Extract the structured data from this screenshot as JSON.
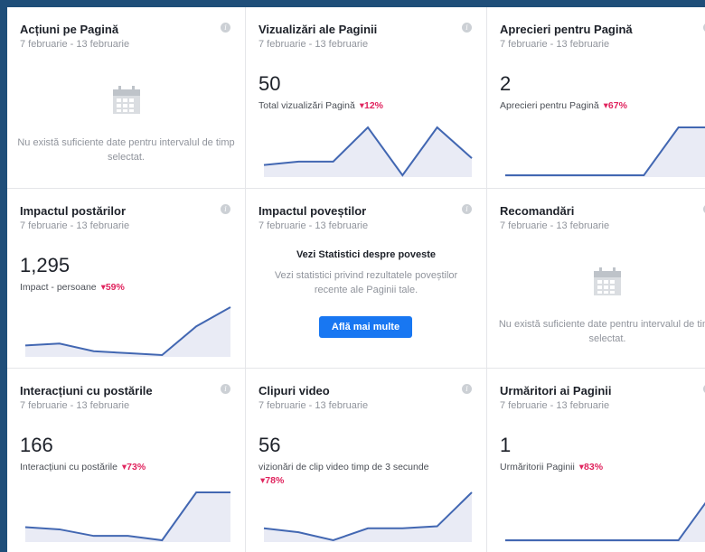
{
  "date_range": "7 februarie - 13 februarie",
  "empty_message": "Nu există suficiente date pentru intervalul de timp selectat.",
  "info_glyph": "i",
  "colors": {
    "accent": "#1877f2",
    "negative": "#e0245e",
    "line": "#4267b2",
    "fill": "#e9ebf5"
  },
  "cards": {
    "page_actions": {
      "title": "Acțiuni pe Pagină"
    },
    "page_views": {
      "title": "Vizualizări ale Paginii",
      "value": "50",
      "metric": "Total vizualizări Pagină",
      "delta": "▾12%",
      "trend": [
        3,
        4,
        4,
        14,
        0,
        14,
        5
      ]
    },
    "page_likes": {
      "title": "Aprecieri pentru Pagină",
      "value": "2",
      "metric": "Aprecieri pentru Pagină",
      "delta": "▾67%",
      "trend": [
        0,
        0,
        0,
        0,
        0,
        1,
        1
      ]
    },
    "post_reach": {
      "title": "Impactul postărilor",
      "value": "1,295",
      "metric": "Impact - persoane",
      "delta": "▾59%",
      "trend": [
        4,
        4.5,
        2.5,
        2,
        1.5,
        9,
        14
      ]
    },
    "story_reach": {
      "title": "Impactul poveștilor",
      "heading": "Vezi Statistici despre poveste",
      "description": "Vezi statistici privind rezultatele poveștilor recente ale Paginii tale.",
      "button": "Află mai multe"
    },
    "recommendations": {
      "title": "Recomandări"
    },
    "post_engagement": {
      "title": "Interacțiuni cu postările",
      "value": "166",
      "metric": "Interacțiuni cu postările",
      "delta": "▾73%",
      "trend": [
        6,
        5.5,
        4,
        4,
        3,
        14,
        14
      ]
    },
    "videos": {
      "title": "Clipuri video",
      "value": "56",
      "metric": "vizionări de clip video timp de 3 secunde",
      "delta": "▾78%",
      "trend": [
        4,
        3,
        1,
        4,
        4,
        4.5,
        13
      ]
    },
    "page_followers": {
      "title": "Urmăritori ai Paginii",
      "value": "1",
      "metric": "Urmăritorii Paginii",
      "delta": "▾83%",
      "trend": [
        0,
        0,
        0,
        0,
        0,
        0,
        1.6
      ]
    }
  }
}
